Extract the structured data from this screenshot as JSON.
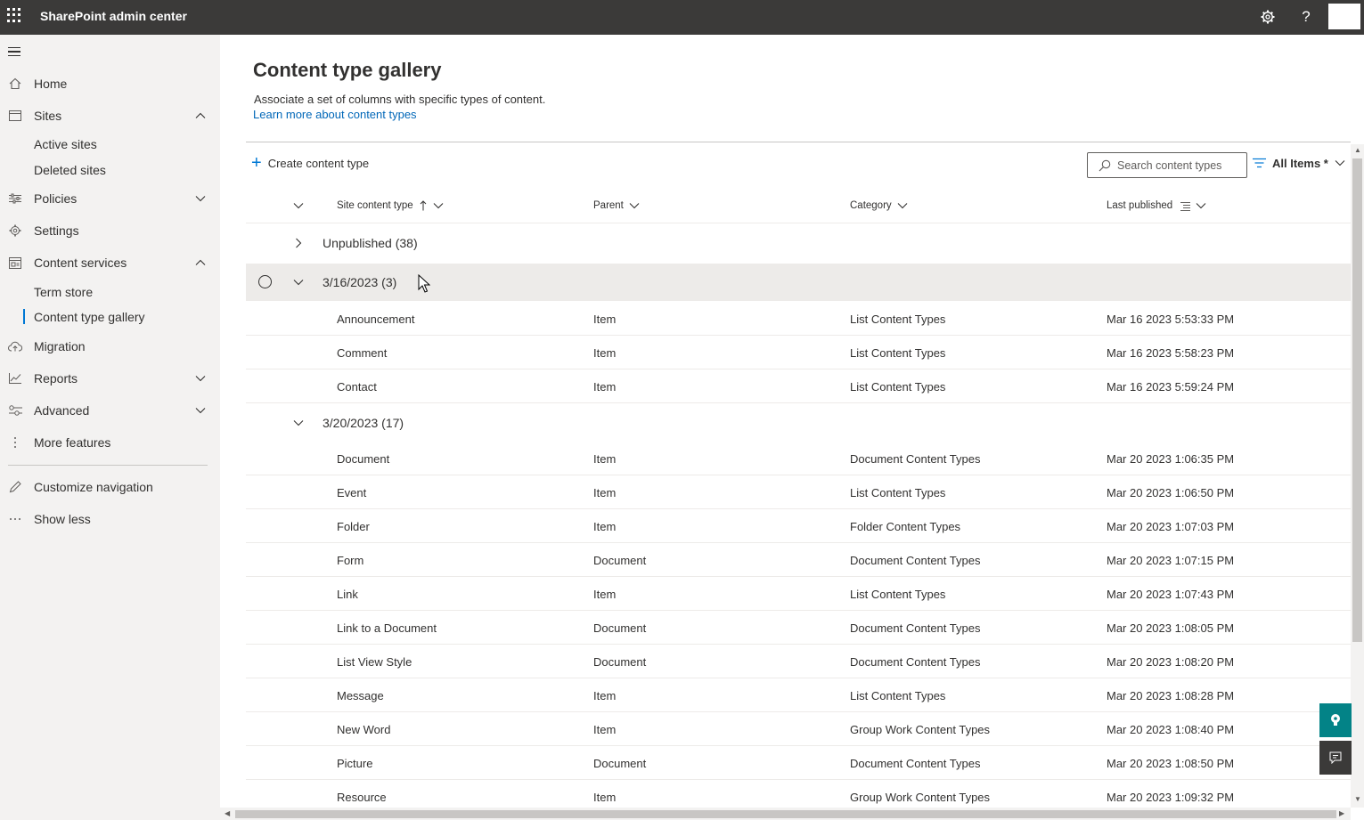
{
  "app": {
    "title": "SharePoint admin center"
  },
  "nav": {
    "home": "Home",
    "sites": "Sites",
    "active_sites": "Active sites",
    "deleted_sites": "Deleted sites",
    "policies": "Policies",
    "settings": "Settings",
    "content_services": "Content services",
    "term_store": "Term store",
    "content_type_gallery": "Content type gallery",
    "migration": "Migration",
    "reports": "Reports",
    "advanced": "Advanced",
    "more_features": "More features",
    "customize_navigation": "Customize navigation",
    "show_less": "Show less"
  },
  "page": {
    "title": "Content type gallery",
    "description": "Associate a set of columns with specific types of content.",
    "learn_more": "Learn more about content types"
  },
  "toolbar": {
    "create_label": "Create content type",
    "search_placeholder": "Search content types",
    "view_label": "All Items *"
  },
  "columns": {
    "name": "Site content type",
    "parent": "Parent",
    "category": "Category",
    "last_published": "Last published"
  },
  "groups": {
    "unpublished": "Unpublished (38)",
    "g1": "3/16/2023 (3)",
    "g2": "3/20/2023 (17)"
  },
  "rows_g1": [
    {
      "name": "Announcement",
      "parent": "Item",
      "category": "List Content Types",
      "published": "Mar 16 2023 5:53:33 PM"
    },
    {
      "name": "Comment",
      "parent": "Item",
      "category": "List Content Types",
      "published": "Mar 16 2023 5:58:23 PM"
    },
    {
      "name": "Contact",
      "parent": "Item",
      "category": "List Content Types",
      "published": "Mar 16 2023 5:59:24 PM"
    }
  ],
  "rows_g2": [
    {
      "name": "Document",
      "parent": "Item",
      "category": "Document Content Types",
      "published": "Mar 20 2023 1:06:35 PM"
    },
    {
      "name": "Event",
      "parent": "Item",
      "category": "List Content Types",
      "published": "Mar 20 2023 1:06:50 PM"
    },
    {
      "name": "Folder",
      "parent": "Item",
      "category": "Folder Content Types",
      "published": "Mar 20 2023 1:07:03 PM"
    },
    {
      "name": "Form",
      "parent": "Document",
      "category": "Document Content Types",
      "published": "Mar 20 2023 1:07:15 PM"
    },
    {
      "name": "Link",
      "parent": "Item",
      "category": "List Content Types",
      "published": "Mar 20 2023 1:07:43 PM"
    },
    {
      "name": "Link to a Document",
      "parent": "Document",
      "category": "Document Content Types",
      "published": "Mar 20 2023 1:08:05 PM"
    },
    {
      "name": "List View Style",
      "parent": "Document",
      "category": "Document Content Types",
      "published": "Mar 20 2023 1:08:20 PM"
    },
    {
      "name": "Message",
      "parent": "Item",
      "category": "List Content Types",
      "published": "Mar 20 2023 1:08:28 PM"
    },
    {
      "name": "New Word",
      "parent": "Item",
      "category": "Group Work Content Types",
      "published": "Mar 20 2023 1:08:40 PM"
    },
    {
      "name": "Picture",
      "parent": "Document",
      "category": "Document Content Types",
      "published": "Mar 20 2023 1:08:50 PM"
    },
    {
      "name": "Resource",
      "parent": "Item",
      "category": "Group Work Content Types",
      "published": "Mar 20 2023 1:09:32 PM"
    }
  ],
  "icons": {
    "app_launcher": "waffle-icon",
    "settings": "gear-icon",
    "help": "help-icon",
    "search": "search-icon",
    "filter": "filter-icon"
  },
  "colors": {
    "topbar": "#3b3a39",
    "accent": "#0078d4",
    "link": "#0067b8",
    "side_button": "#038387"
  }
}
